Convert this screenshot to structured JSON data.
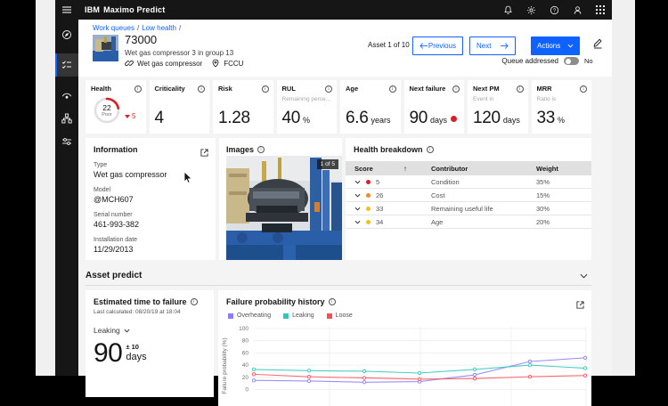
{
  "topbar": {
    "brand": "IBM",
    "product": "Maximo Predict",
    "icons": [
      "notifications-bell-icon",
      "settings-gear-icon",
      "help-icon",
      "user-avatar-icon",
      "app-switcher-icon"
    ]
  },
  "sidebar": {
    "items": [
      "explore",
      "work-queues",
      "monitor-insights",
      "asset-hierarchy",
      "configuration"
    ],
    "active": "work-queues"
  },
  "breadcrumb": {
    "items": [
      "Work queues",
      "Low health"
    ],
    "sep": "/"
  },
  "asset": {
    "id": "73000",
    "description": "Wet gas compressor 3 in group 13",
    "type_tag": "Wet gas compressor",
    "location_tag": "FCCU"
  },
  "pager": {
    "label": "Asset 1 of 10",
    "previous": "Previous",
    "next": "Next",
    "actions": "Actions"
  },
  "queue": {
    "label": "Queue addressed",
    "state": "No"
  },
  "metrics": [
    {
      "id": "health",
      "label": "Health",
      "type": "gauge",
      "value": "22",
      "sub": "Poor",
      "delta": "5"
    },
    {
      "id": "criticality",
      "label": "Criticality",
      "value": "4"
    },
    {
      "id": "risk",
      "label": "Risk",
      "value": "1.28"
    },
    {
      "id": "rul",
      "label": "RUL",
      "pre": "Remaining perce...",
      "value": "40",
      "unit": "%"
    },
    {
      "id": "age",
      "label": "Age",
      "value": "6.6",
      "unit": "years"
    },
    {
      "id": "next-failure",
      "label": "Next failure",
      "value": "90",
      "unit": "days",
      "alert": true
    },
    {
      "id": "next-pm",
      "label": "Next PM",
      "pre": "Event in",
      "value": "120",
      "unit": "days"
    },
    {
      "id": "mrr",
      "label": "MRR",
      "pre": "Ratio is",
      "value": "33",
      "unit": "%"
    }
  ],
  "information": {
    "title": "Information",
    "fields": [
      {
        "label": "Type",
        "value": "Wet gas compressor"
      },
      {
        "label": "Model",
        "value": "@MCH607"
      },
      {
        "label": "Serial number",
        "value": "461-993-382"
      },
      {
        "label": "Installation date",
        "value": "11/29/2013"
      }
    ]
  },
  "images": {
    "title": "Images",
    "badge": "1 of 5"
  },
  "health_breakdown": {
    "title": "Health breakdown",
    "columns": [
      "Score",
      "Contributor",
      "Weight"
    ],
    "sort": "asc",
    "rows": [
      {
        "score": "5",
        "color": "#da1e28",
        "contributor": "Condition",
        "weight": "35%"
      },
      {
        "score": "26",
        "color": "#ff832b",
        "contributor": "Cost",
        "weight": "15%"
      },
      {
        "score": "33",
        "color": "#f1c21b",
        "contributor": "Remaining useful life",
        "weight": "30%"
      },
      {
        "score": "34",
        "color": "#f1c21b",
        "contributor": "Age",
        "weight": "20%"
      }
    ]
  },
  "asset_predict": {
    "title": "Asset predict"
  },
  "estimated_time_to_failure": {
    "title": "Estimated time to failure",
    "last_calculated": "Last calculated: 08/20/19 at 18:04",
    "mode": "Leaking",
    "value": "90",
    "tolerance": "± 10",
    "unit": "days"
  },
  "chart_data": {
    "type": "line",
    "title": "Failure probability history",
    "ylabel": "Failure probability (%)",
    "ylim": [
      0,
      100
    ],
    "yticks": [
      100,
      80,
      60,
      40,
      20,
      0
    ],
    "grid": true,
    "legend_position": "top",
    "x": [
      1,
      2,
      3,
      4,
      5,
      6,
      7
    ],
    "series": [
      {
        "name": "Overheating",
        "color": "#8a7cf7",
        "values": [
          15,
          14,
          12,
          13,
          24,
          46,
          52
        ]
      },
      {
        "name": "Leaking",
        "color": "#2fc6bc",
        "values": [
          33,
          31,
          30,
          27,
          33,
          40,
          35
        ]
      },
      {
        "name": "Loose",
        "color": "#fa4d56",
        "values": [
          25,
          21,
          19,
          17,
          18,
          21,
          23
        ]
      }
    ]
  },
  "colors": {
    "accent": "#0f62fe",
    "red": "#da1e28",
    "orange": "#ff832b",
    "yellow": "#f1c21b",
    "topbar_bg": "#161616",
    "content_bg": "#f4f4f4"
  }
}
